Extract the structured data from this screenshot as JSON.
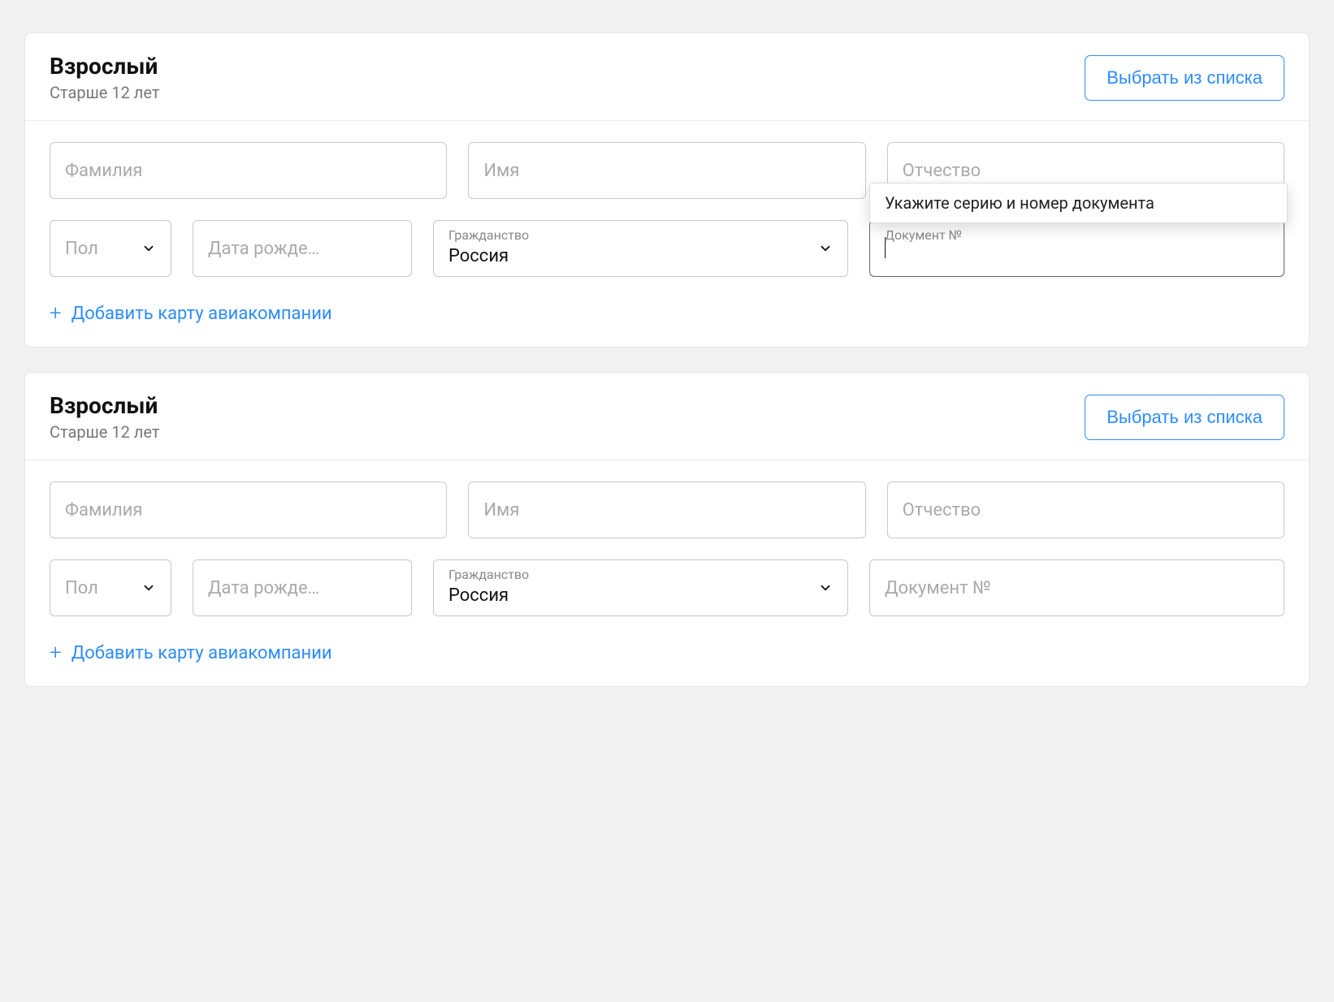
{
  "common": {
    "select_from_list": "Выбрать из списка",
    "add_airline_card": "Добавить карту авиакомпании",
    "tooltip_doc": "Укажите серию и номер документа"
  },
  "labels": {
    "lastname": "Фамилия",
    "firstname": "Имя",
    "middlename": "Отчество",
    "gender": "Пол",
    "dob": "Дата рожде…",
    "citizenship": "Гражданство",
    "citizenship_value": "Россия",
    "document": "Документ №"
  },
  "passengers": [
    {
      "title": "Взрослый",
      "subtitle": "Старше 12 лет",
      "doc_focused": true,
      "show_tooltip": true
    },
    {
      "title": "Взрослый",
      "subtitle": "Старше 12 лет",
      "doc_focused": false,
      "show_tooltip": false
    }
  ]
}
